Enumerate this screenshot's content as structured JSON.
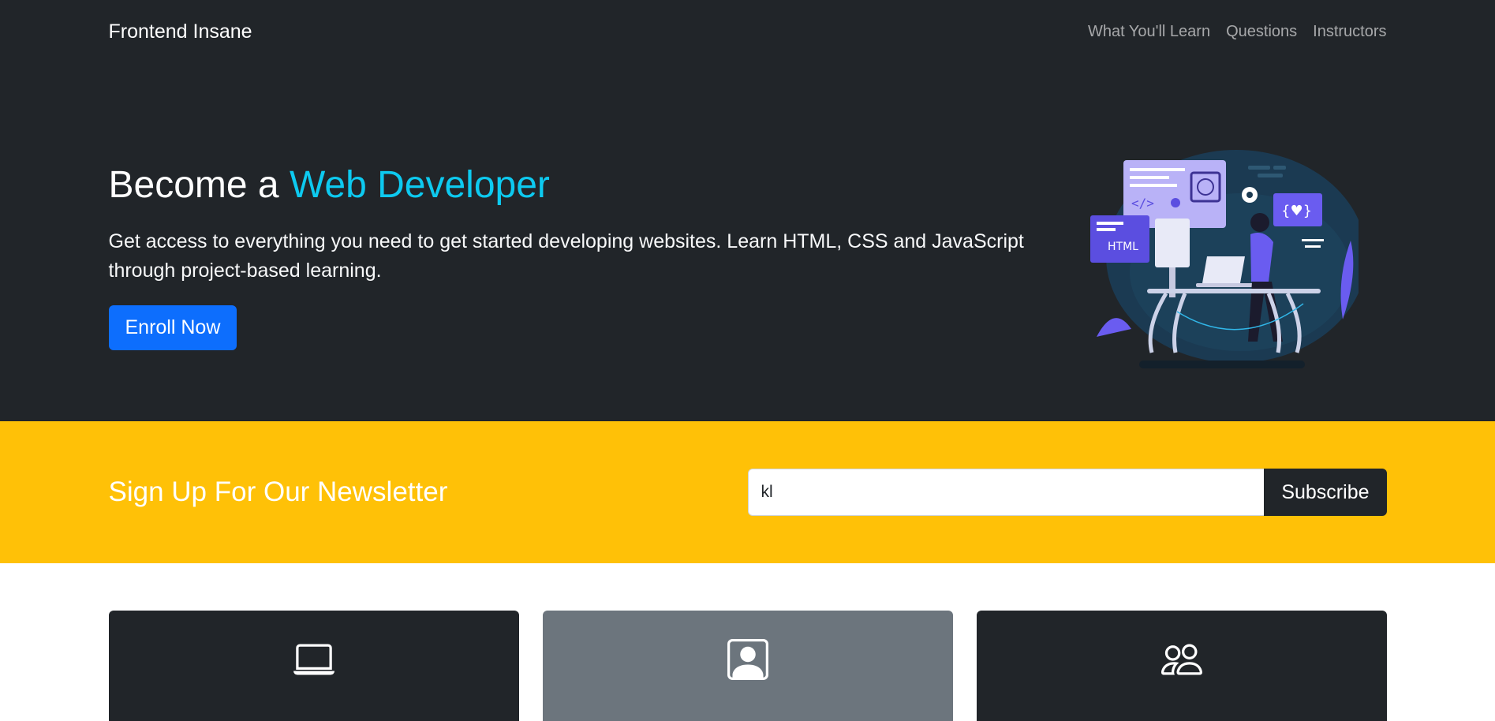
{
  "nav": {
    "brand": "Frontend Insane",
    "links": [
      "What You'll Learn",
      "Questions",
      "Instructors"
    ]
  },
  "hero": {
    "title_prefix": "Become a ",
    "title_accent": "Web Developer",
    "lead": "Get access to everything you need to get started developing websites. Learn HTML, CSS and JavaScript through project-based learning.",
    "enroll_label": "Enroll Now",
    "illustration_label": "HTML"
  },
  "newsletter": {
    "title": "Sign Up For Our Newsletter",
    "input_value": "kl",
    "subscribe_label": "Subscribe"
  },
  "cards": [
    {
      "icon": "laptop-icon"
    },
    {
      "icon": "person-square-icon"
    },
    {
      "icon": "people-icon"
    }
  ],
  "colors": {
    "dark": "#212529",
    "accent": "#0dcaf0",
    "primary": "#0d6efd",
    "warning": "#ffc107",
    "secondary": "#6c757d"
  }
}
